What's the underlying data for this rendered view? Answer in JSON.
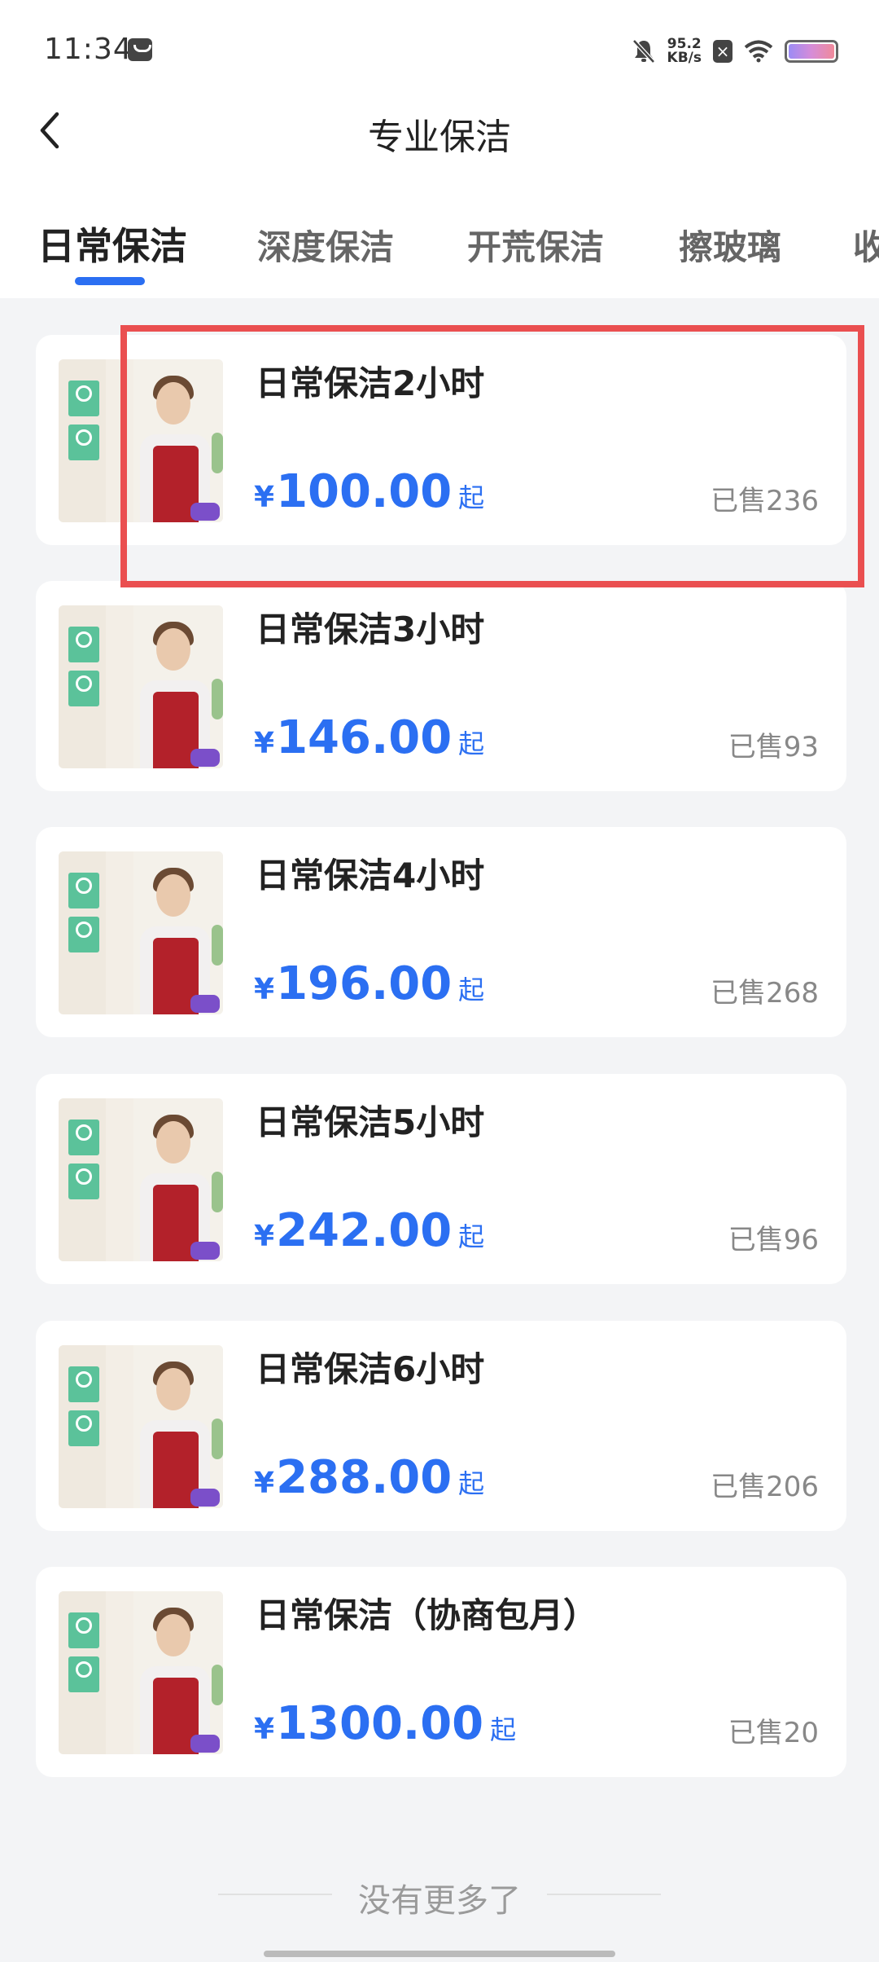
{
  "status_bar": {
    "time": "11:34",
    "speed_value": "95.2",
    "speed_unit": "KB/s"
  },
  "header": {
    "title": "专业保洁"
  },
  "tabs": [
    {
      "label": "日常保洁",
      "active": true
    },
    {
      "label": "深度保洁",
      "active": false
    },
    {
      "label": "开荒保洁",
      "active": false
    },
    {
      "label": "擦玻璃",
      "active": false
    },
    {
      "label": "收",
      "active": false
    }
  ],
  "products": [
    {
      "title": "日常保洁2小时",
      "currency": "¥",
      "price": "100.00",
      "suffix": "起",
      "sold": "已售236"
    },
    {
      "title": "日常保洁3小时",
      "currency": "¥",
      "price": "146.00",
      "suffix": "起",
      "sold": "已售93"
    },
    {
      "title": "日常保洁4小时",
      "currency": "¥",
      "price": "196.00",
      "suffix": "起",
      "sold": "已售268"
    },
    {
      "title": "日常保洁5小时",
      "currency": "¥",
      "price": "242.00",
      "suffix": "起",
      "sold": "已售96"
    },
    {
      "title": "日常保洁6小时",
      "currency": "¥",
      "price": "288.00",
      "suffix": "起",
      "sold": "已售206"
    },
    {
      "title": "日常保洁（协商包月）",
      "currency": "¥",
      "price": "1300.00",
      "suffix": "起",
      "sold": "已售20"
    }
  ],
  "footer": {
    "end_text": "没有更多了"
  },
  "colors": {
    "accent": "#2b6ff2",
    "highlight": "#ea4f50",
    "background": "#f3f4f6"
  }
}
